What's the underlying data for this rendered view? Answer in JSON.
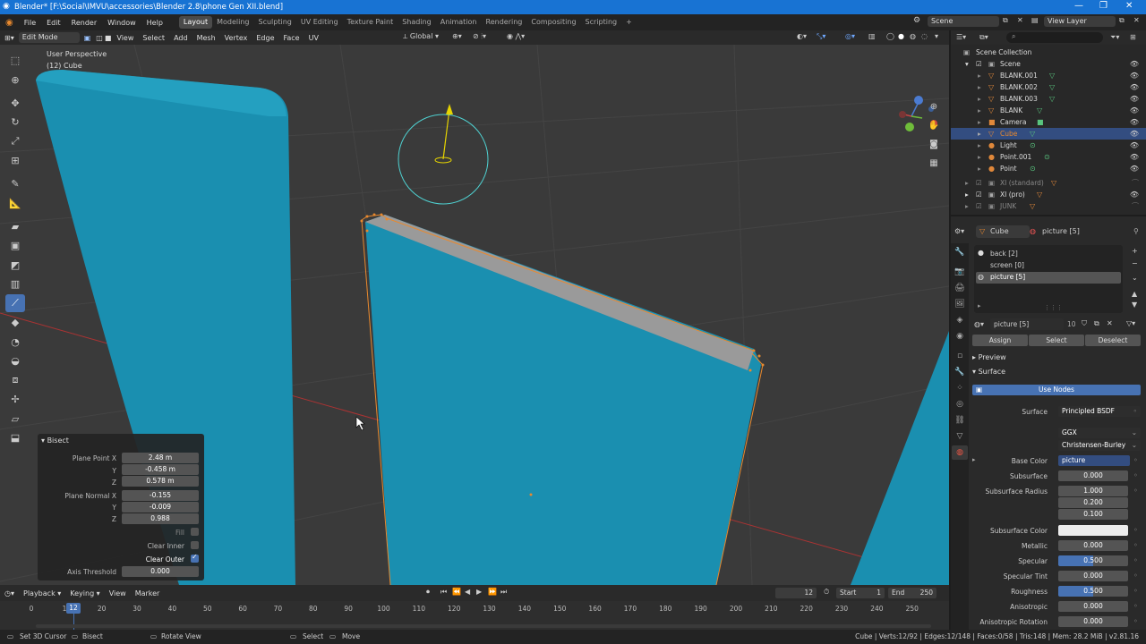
{
  "window": {
    "title": "Blender* [F:\\Social\\IMVU\\accessories\\Blender 2.8\\phone Gen XII.blend]"
  },
  "menu": [
    "File",
    "Edit",
    "Render",
    "Window",
    "Help"
  ],
  "workspaces": [
    "Layout",
    "Modeling",
    "Sculpting",
    "UV Editing",
    "Texture Paint",
    "Shading",
    "Animation",
    "Rendering",
    "Compositing",
    "Scripting"
  ],
  "active_workspace": "Layout",
  "scene_field": "Scene",
  "view_layer_field": "View Layer",
  "viewport_header": {
    "mode": "Edit Mode",
    "menus": [
      "View",
      "Select",
      "Add",
      "Mesh",
      "Vertex",
      "Edge",
      "Face",
      "UV"
    ],
    "orientation": "Global"
  },
  "viewport": {
    "perspective": "User Perspective",
    "object_label": "(12) Cube",
    "colors": {
      "background": "#3a3a3a",
      "mesh": "#1a8fb0",
      "face_top": "#9a9a9a",
      "edge_sel": "#e8892e"
    }
  },
  "bisect": {
    "title": "Bisect",
    "plane_point_label": "Plane Point X",
    "plane_point": [
      "2.48 m",
      "-0.458 m",
      "0.578 m"
    ],
    "plane_normal_label": "Plane Normal X",
    "plane_normal": [
      "-0.155",
      "-0.009",
      "0.988"
    ],
    "axis_y": "Y",
    "axis_z": "Z",
    "fill_label": "Fill",
    "fill": false,
    "clear_inner_label": "Clear Inner",
    "clear_inner": false,
    "clear_outer_label": "Clear Outer",
    "clear_outer": true,
    "axis_threshold_label": "Axis Threshold",
    "axis_threshold": "0.000"
  },
  "outliner": {
    "root": "Scene Collection",
    "scene": "Scene",
    "items": [
      {
        "name": "BLANK.001",
        "selected": false,
        "dim": false
      },
      {
        "name": "BLANK.002",
        "selected": false,
        "dim": false
      },
      {
        "name": "BLANK.003",
        "selected": false,
        "dim": false
      },
      {
        "name": "BLANK",
        "selected": false,
        "dim": false
      },
      {
        "name": "Camera",
        "selected": false,
        "dim": false
      },
      {
        "name": "Cube",
        "selected": true,
        "dim": false
      },
      {
        "name": "Light",
        "selected": false,
        "dim": false
      },
      {
        "name": "Point.001",
        "selected": false,
        "dim": false
      },
      {
        "name": "Point",
        "selected": false,
        "dim": false
      }
    ],
    "collections": [
      {
        "name": "XI (standard)",
        "dim": true
      },
      {
        "name": "XI (pro)",
        "dim": false
      },
      {
        "name": "JUNK",
        "dim": true
      }
    ]
  },
  "properties": {
    "object": "Cube",
    "material_header": "picture [5]",
    "slots": [
      "back [2]",
      "screen [0]",
      "picture [5]"
    ],
    "material_name": "picture [5]",
    "users": "10",
    "assign": "Assign",
    "select": "Select",
    "deselect": "Deselect",
    "preview": "Preview",
    "surface_section": "Surface",
    "use_nodes": "Use Nodes",
    "surface_label": "Surface",
    "surface_value": "Principled BSDF",
    "distribution": "GGX",
    "subsurface_method": "Christensen-Burley",
    "fields": [
      {
        "label": "Base Color",
        "value": "picture"
      },
      {
        "label": "Subsurface",
        "value": "0.000"
      },
      {
        "label": "Subsurface Radius",
        "value": "1.000"
      },
      {
        "label": "",
        "value": "0.200"
      },
      {
        "label": "",
        "value": "0.100"
      },
      {
        "label": "Subsurface Color",
        "value": ""
      },
      {
        "label": "Metallic",
        "value": "0.000"
      },
      {
        "label": "Specular",
        "value": "0.500"
      },
      {
        "label": "Specular Tint",
        "value": "0.000"
      },
      {
        "label": "Roughness",
        "value": "0.500"
      },
      {
        "label": "Anisotropic",
        "value": "0.000"
      },
      {
        "label": "Anisotropic Rotation",
        "value": "0.000"
      }
    ]
  },
  "timeline": {
    "menus": [
      "Playback",
      "Keying",
      "View",
      "Marker"
    ],
    "current_frame": "12",
    "start_label": "Start",
    "start": "1",
    "end_label": "End",
    "end": "250",
    "ticks": [
      "0",
      "10",
      "20",
      "30",
      "40",
      "50",
      "60",
      "70",
      "80",
      "90",
      "100",
      "110",
      "120",
      "130",
      "140",
      "150",
      "160",
      "170",
      "180",
      "190",
      "200",
      "210",
      "220",
      "230",
      "240",
      "250"
    ]
  },
  "statusbar": {
    "hints": [
      "Set 3D Cursor",
      "Bisect",
      "Rotate View",
      "Select",
      "Move"
    ],
    "stats": "Cube | Verts:12/92 | Edges:12/148 | Faces:0/58 | Tris:148 | Mem: 28.2 MiB | v2.81.16"
  }
}
